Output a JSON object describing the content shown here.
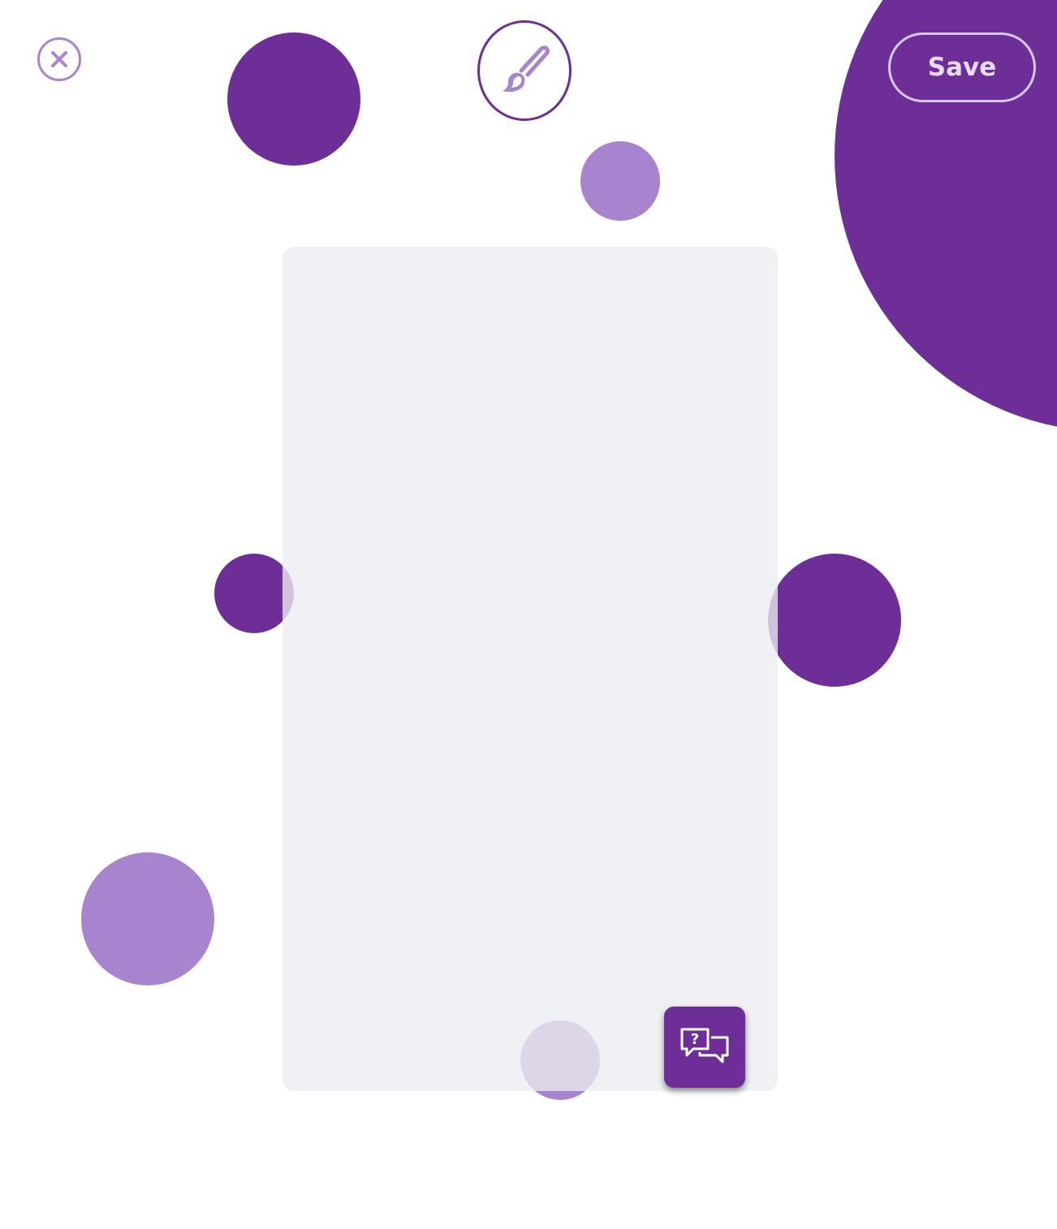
{
  "toolbar": {
    "save_label": "Save",
    "close_icon": "close-icon",
    "brush_icon": "paintbrush-icon"
  },
  "help": {
    "icon": "help-chat-icon"
  },
  "colors": {
    "accent_dark": "#6d2f97",
    "accent_light": "#a884ce",
    "canvas_bg": "#ecedf1",
    "save_text": "#e6dcf1"
  }
}
